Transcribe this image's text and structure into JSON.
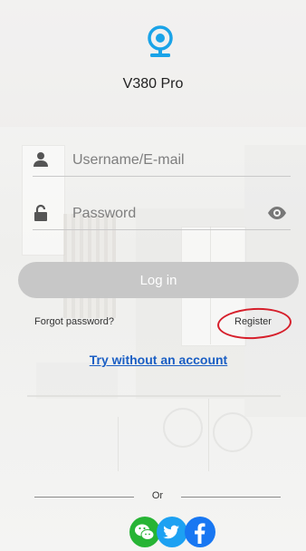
{
  "app": {
    "name": "V380 Pro"
  },
  "login": {
    "username_placeholder": "Username/E-mail",
    "password_placeholder": "Password",
    "login_label": "Log in",
    "forgot_label": "Forgot password?",
    "register_label": "Register",
    "try_label": "Try without an account"
  },
  "social": {
    "or_label": "Or",
    "icons": [
      "wechat-icon",
      "twitter-icon",
      "facebook-icon"
    ]
  },
  "colors": {
    "logo": "#1aa3e8",
    "button_disabled": "#c7c7c7",
    "link": "#1b5fc4",
    "annotation": "#d61f2b",
    "wechat": "#27b435",
    "twitter": "#1da1f2",
    "facebook": "#1877f2"
  }
}
